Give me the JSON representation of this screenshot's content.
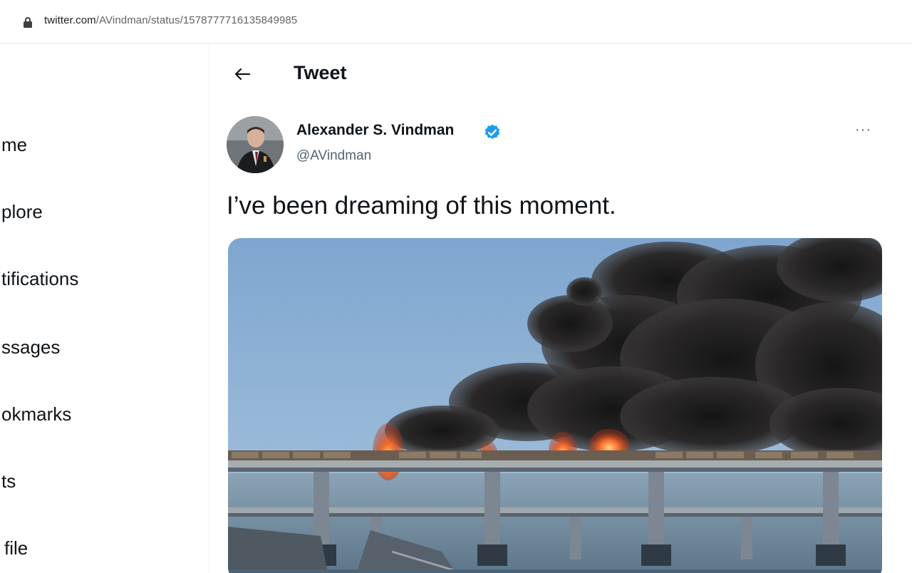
{
  "browser": {
    "url_host": "twitter.com",
    "url_path": "/AVindman/status/1578777716135849985"
  },
  "sidebar": {
    "items": [
      {
        "label": "me"
      },
      {
        "label": "plore"
      },
      {
        "label": "tifications"
      },
      {
        "label": "ssages"
      },
      {
        "label": "okmarks"
      },
      {
        "label": "ts"
      },
      {
        "label": "file"
      }
    ]
  },
  "header": {
    "title": "Tweet"
  },
  "tweet": {
    "author_name": "Alexander S. Vindman",
    "author_handle": "@AVindman",
    "more_label": "···",
    "text": "I’ve been dreaming of this moment.",
    "verified": true
  },
  "colors": {
    "verified_blue": "#1d9bf0",
    "secondary_text": "#536471",
    "sky": "#8fb3d6",
    "smoke": "#1f1d1e",
    "fire": "#f2672a"
  }
}
